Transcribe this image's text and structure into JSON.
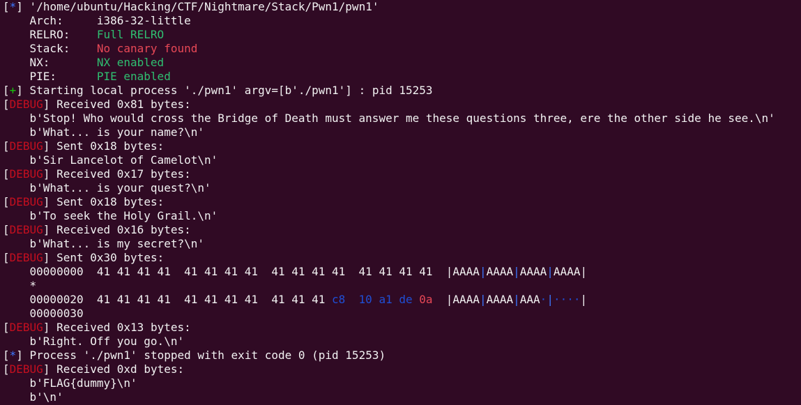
{
  "terminal": {
    "bg": "#300a24",
    "lines": [
      {
        "t": "info",
        "marker": "*",
        "text": " '/home/ubuntu/Hacking/CTF/Nightmare/Stack/Pwn1/pwn1'"
      },
      {
        "t": "kv",
        "key": "    Arch:     ",
        "val": "i386-32-little",
        "cls": "w"
      },
      {
        "t": "kv",
        "key": "    RELRO:    ",
        "val": "Full RELRO",
        "cls": "ok"
      },
      {
        "t": "kv",
        "key": "    Stack:    ",
        "val": "No canary found",
        "cls": "red"
      },
      {
        "t": "kv",
        "key": "    NX:       ",
        "val": "NX enabled",
        "cls": "ok"
      },
      {
        "t": "kv",
        "key": "    PIE:      ",
        "val": "PIE enabled",
        "cls": "ok"
      },
      {
        "t": "plus",
        "marker": "+",
        "text": " Starting local process './pwn1' argv=[b'./pwn1'] : pid 15253"
      },
      {
        "t": "debug",
        "text": " Received 0x81 bytes:"
      },
      {
        "t": "plain",
        "text": "    b'Stop! Who would cross the Bridge of Death must answer me these questions three, ere the other side he see.\\n'"
      },
      {
        "t": "plain",
        "text": "    b'What... is your name?\\n'"
      },
      {
        "t": "debug",
        "text": " Sent 0x18 bytes:"
      },
      {
        "t": "plain",
        "text": "    b'Sir Lancelot of Camelot\\n'"
      },
      {
        "t": "debug",
        "text": " Received 0x17 bytes:"
      },
      {
        "t": "plain",
        "text": "    b'What... is your quest?\\n'"
      },
      {
        "t": "debug",
        "text": " Sent 0x18 bytes:"
      },
      {
        "t": "plain",
        "text": "    b'To seek the Holy Grail.\\n'"
      },
      {
        "t": "debug",
        "text": " Received 0x16 bytes:"
      },
      {
        "t": "plain",
        "text": "    b'What... is my secret?\\n'"
      },
      {
        "t": "debug",
        "text": " Sent 0x30 bytes:"
      },
      {
        "t": "hex1"
      },
      {
        "t": "plain",
        "text": "    *"
      },
      {
        "t": "hex2"
      },
      {
        "t": "plain",
        "text": "    00000030"
      },
      {
        "t": "debug",
        "text": " Received 0x13 bytes:"
      },
      {
        "t": "plain",
        "text": "    b'Right. Off you go.\\n'"
      },
      {
        "t": "info",
        "marker": "*",
        "text": " Process './pwn1' stopped with exit code 0 (pid 15253)"
      },
      {
        "t": "debug",
        "text": " Received 0xd bytes:"
      },
      {
        "t": "plain",
        "text": "    b'FLAG{dummy}\\n'"
      },
      {
        "t": "plain",
        "text": "    b'\\n'"
      }
    ],
    "debug_label": "DEBUG",
    "hex_row1": {
      "offset": "    00000000  ",
      "bytes": "41 41 41 41  41 41 41 41  41 41 41 41  41 41 41 41  ",
      "ascii": [
        "AAAA",
        "AAAA",
        "AAAA",
        "AAAA"
      ]
    },
    "hex_row2": {
      "offset": "    00000020  ",
      "bytes_a": "41 41 41 41  41 41 41 41  41 41 41 ",
      "bytes_b": "c8  10 a1 de ",
      "bytes_c": "0a",
      "tail": "  ",
      "ascii": [
        "AAAA",
        "AAAA",
        "AAA",
        "····"
      ],
      "ascii_dot": "·"
    }
  }
}
